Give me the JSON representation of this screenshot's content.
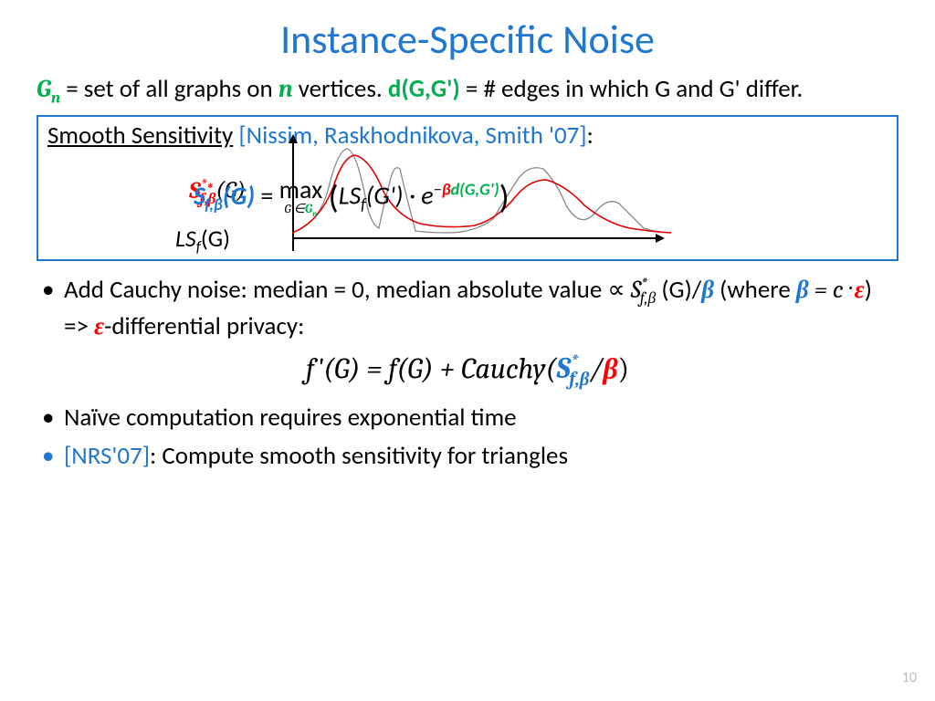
{
  "title": "Instance-Specific Noise",
  "def": {
    "gn": "G",
    "gn_sub": "n",
    "gn_text": " = set of all graphs on ",
    "n": "n",
    "gn_text2": " vertices. ",
    "d": "d(G,G')",
    "d_text": " = # edges in which G and G' differ."
  },
  "box": {
    "head1": "Smooth Sensitivity",
    "cite": " [Nissim, Raskhodnikova, Smith '07]",
    "colon": ":",
    "sfb_red": "S",
    "sfb_red_sup": "*",
    "sfb_red_sub": "f,β",
    "sfb_red_g": "(G)",
    "ls_label": "LS",
    "ls_sub": "f",
    "ls_g": "(G)",
    "formula": {
      "S": "S",
      "S_star": "*",
      "S_sub": "f,β",
      "G": "(G)",
      "eq": " = ",
      "max": "max",
      "max_under_a": "G'∈",
      "max_under_b": "G",
      "max_under_c": "n",
      "lp": "(",
      "ls": "LS",
      "ls_f": "f",
      "gp": "(G') · e",
      "exp_minus": "−",
      "exp_beta": "β",
      "exp_d": "d(G,G')",
      "rp": ")"
    }
  },
  "bul1": {
    "a": "Add Cauchy noise: median = 0, median absolute value ∝ ",
    "s": "S",
    "s_star": "*",
    "s_sub": "f,β",
    "g": " (G)/",
    "beta1": "β",
    "w": " (where ",
    "beta2": "β",
    "eq": " = c · ",
    "eps1": "ε",
    "arrow": ") => ",
    "eps2": "ε",
    "diff": "-differential privacy:"
  },
  "eq2": {
    "lhs": "f'(G) =  f(G) + Cauchy(",
    "S": "S",
    "S_star": "*",
    "S_sub": "f,β",
    "slash": "/",
    "beta": "β",
    "rp": ")"
  },
  "bul2": "Naïve computation requires exponential time",
  "bul3": {
    "cite": "[NRS'07]",
    "text": ": Compute smooth sensitivity for triangles"
  },
  "pagenum": "10"
}
